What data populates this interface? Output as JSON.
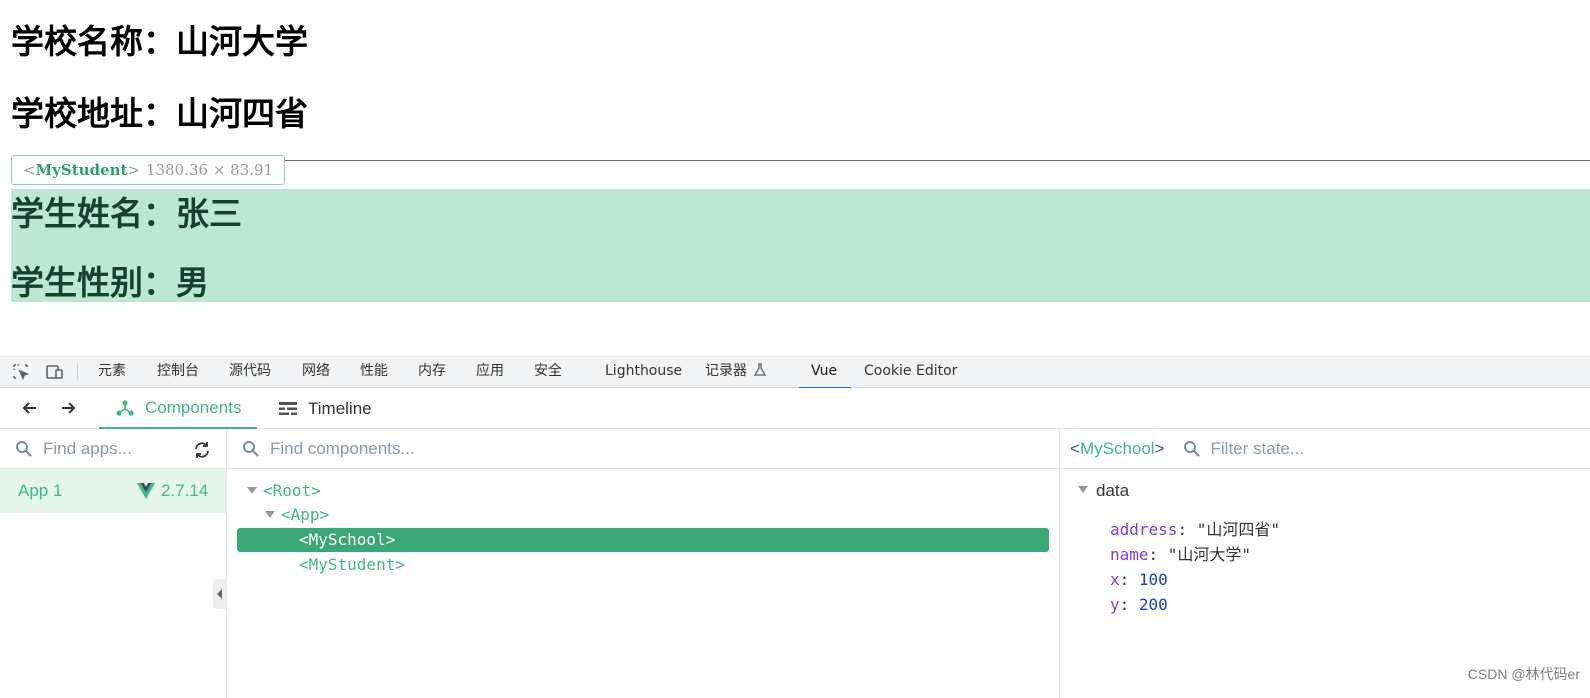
{
  "page": {
    "school_name_line": "学校名称：山河大学",
    "school_address_line": "学校地址：山河四省",
    "student_name_line": "学生姓名：张三",
    "student_gender_line": "学生性别：男",
    "highlight": {
      "open_bracket": "<",
      "component": "MyStudent",
      "close_bracket": ">",
      "dimensions": "1380.36 × 83.91"
    }
  },
  "devtools": {
    "tabs": [
      "元素",
      "控制台",
      "源代码",
      "网络",
      "性能",
      "内存",
      "应用",
      "安全",
      "Lighthouse",
      "记录器",
      "Vue",
      "Cookie Editor"
    ],
    "active_tab": "Vue",
    "tool_icons": [
      "inspect-element-icon",
      "device-toolbar-icon"
    ]
  },
  "vue": {
    "nav_icons": [
      "back-arrow-icon",
      "forward-arrow-icon"
    ],
    "tabs": {
      "components": "Components",
      "timeline": "Timeline"
    },
    "active_tab": "Components",
    "apps_search_placeholder": "Find apps...",
    "apps": [
      {
        "name": "App 1",
        "version": "2.7.14"
      }
    ],
    "components_search_placeholder": "Find components...",
    "tree": {
      "root": "<Root>",
      "app": "<App>",
      "school": "<MySchool>",
      "student": "<MyStudent>"
    },
    "selected_component": {
      "open": "<",
      "name": "MySchool",
      "close": ">"
    },
    "state_filter_placeholder": "Filter state...",
    "state_section": "data",
    "state": {
      "address_key": "address",
      "address_value": "\"山河四省\"",
      "name_key": "name",
      "name_value": "\"山河大学\"",
      "x_key": "x",
      "x_value": "100",
      "y_key": "y",
      "y_value": "200"
    },
    "colors": {
      "accent": "#42b883",
      "selected_row": "#3ba776",
      "highlight_overlay": "#bde6d4"
    }
  },
  "watermark": "CSDN @林代码er"
}
